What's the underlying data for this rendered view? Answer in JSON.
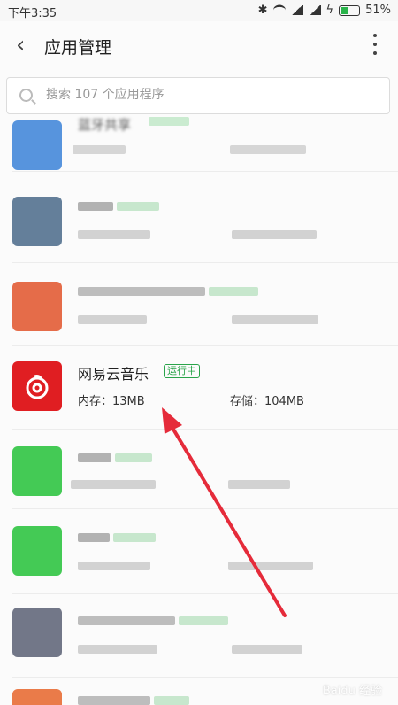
{
  "status_bar": {
    "time": "下午3:35",
    "battery": "51%",
    "battery_level": 0.51
  },
  "header": {
    "title": "应用管理",
    "back_icon": "chevron-left-icon",
    "more_icon": "more-vertical-icon"
  },
  "search": {
    "placeholder": "搜索 107 个应用程序"
  },
  "apps": [
    {
      "name": "蓝牙共享",
      "blurred": true,
      "color": "#2f7bd6"
    },
    {
      "name": "",
      "blurred": true,
      "color": "#4a6a8a"
    },
    {
      "name": "",
      "blurred": true,
      "color": "#e2542b"
    },
    {
      "name": "网易云音乐",
      "status": "运行中",
      "memory": "内存：13MB",
      "storage": "存储：104MB",
      "color": "#e01e22"
    },
    {
      "name": "",
      "blurred": true,
      "color": "#25c239"
    },
    {
      "name": "",
      "blurred": true,
      "color": "#25c239"
    },
    {
      "name": "",
      "blurred": true,
      "color": "#5b6175"
    },
    {
      "name": "",
      "blurred": true,
      "color": "#e8652b"
    }
  ],
  "watermark": "Baidu 经验"
}
